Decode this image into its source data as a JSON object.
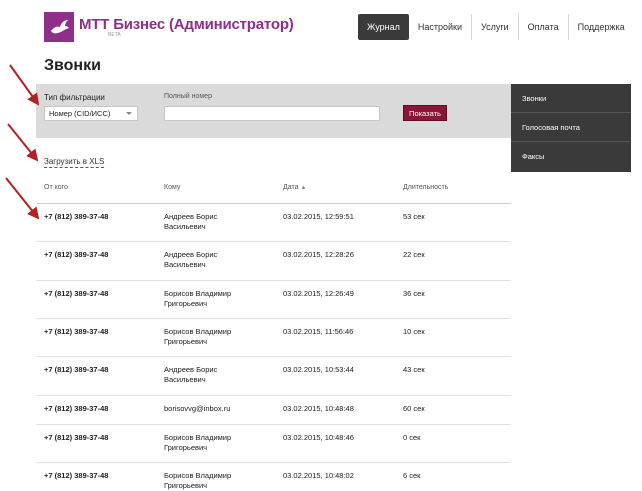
{
  "brand": {
    "logo_name": "mtt-logo-icon",
    "name": "МТТ Бизнес (Администратор)",
    "beta": "BETA",
    "color": "#8e2f8a"
  },
  "nav": [
    {
      "label": "Журнал",
      "active": true
    },
    {
      "label": "Настройки",
      "active": false
    },
    {
      "label": "Услуги",
      "active": false
    },
    {
      "label": "Оплата",
      "active": false
    },
    {
      "label": "Поддержка",
      "active": false
    }
  ],
  "page_title": "Звонки",
  "filter": {
    "type_label": "Тип фильтрации",
    "type_value": "Номер (CID/ИСС)",
    "number_label": "Полный номер",
    "number_value": "",
    "number_placeholder": "",
    "submit_label": "Показать",
    "submit_color": "#8a1538"
  },
  "sidebar": [
    {
      "label": "Звонки"
    },
    {
      "label": "Голосовая почта"
    },
    {
      "label": "Факсы"
    }
  ],
  "export_link": "Загрузить в XLS",
  "table": {
    "headers": {
      "from": "От кого",
      "to": "Кому",
      "date": "Дата",
      "duration": "Длительность"
    },
    "sort_glyph": "▲",
    "rows": [
      {
        "from": "+7 (812) 389-37-48",
        "to1": "Андреев Борис",
        "to2": "Васильевич",
        "date": "03.02.2015, 12:59:51",
        "duration": "53 сек"
      },
      {
        "from": "+7 (812) 389-37-48",
        "to1": "Андреев Борис",
        "to2": "Васильевич",
        "date": "03.02.2015, 12:28:26",
        "duration": "22 сек"
      },
      {
        "from": "+7 (812) 389-37-48",
        "to1": "Борисов Владимир",
        "to2": "Григорьевич",
        "date": "03.02.2015, 12:26:49",
        "duration": "36 сек"
      },
      {
        "from": "+7 (812) 389-37-48",
        "to1": "Борисов Владимир",
        "to2": "Григорьевич",
        "date": "03.02.2015, 11:56:46",
        "duration": "10 сек"
      },
      {
        "from": "+7 (812) 389-37-48",
        "to1": "Андреев Борис",
        "to2": "Васильевич",
        "date": "03.02.2015, 10:53:44",
        "duration": "43 сек"
      },
      {
        "from": "+7 (812) 389-37-48",
        "to1": "borisovvg@inbox.ru",
        "to2": "",
        "date": "03.02.2015, 10:48:48",
        "duration": "60 сек"
      },
      {
        "from": "+7 (812) 389-37-48",
        "to1": "Борисов Владимир",
        "to2": "Григорьевич",
        "date": "03.02.2015, 10:48:46",
        "duration": "0 сек"
      },
      {
        "from": "+7 (812) 389-37-48",
        "to1": "Борисов Владимир",
        "to2": "Григорьевич",
        "date": "03.02.2015, 10:48:02",
        "duration": "6 сек"
      }
    ]
  },
  "annotation_color": "#b22222"
}
